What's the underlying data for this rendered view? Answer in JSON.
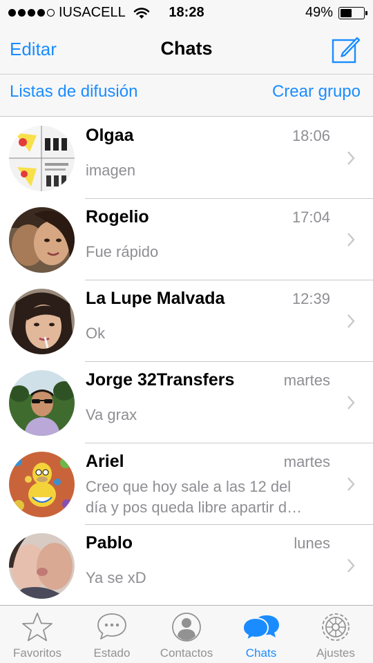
{
  "status_bar": {
    "carrier": "IUSACELL",
    "time": "18:28",
    "battery": "49%",
    "battery_level": 0.49,
    "signal_bars": 4,
    "signal_total": 5
  },
  "nav": {
    "edit_label": "Editar",
    "title": "Chats",
    "compose_icon": "compose-icon"
  },
  "sub_bar": {
    "broadcast_label": "Listas de difusión",
    "new_group_label": "Crear grupo"
  },
  "chats": [
    {
      "name": "Olgaa",
      "time": "18:06",
      "message": [
        "imagen"
      ]
    },
    {
      "name": "Rogelio",
      "time": "17:04",
      "message": [
        "Fue rápido"
      ]
    },
    {
      "name": "La Lupe Malvada",
      "time": "12:39",
      "message": [
        "Ok"
      ]
    },
    {
      "name": "Jorge 32Transfers",
      "time": "martes",
      "message": [
        "Va grax"
      ]
    },
    {
      "name": "Ariel",
      "time": "martes",
      "message": [
        "Creo que hoy sale a las 12 del",
        "día y pos queda libre apartir d…"
      ]
    },
    {
      "name": "Pablo",
      "time": "lunes",
      "message": [
        "Ya se xD"
      ]
    }
  ],
  "tabs": [
    {
      "label": "Favoritos",
      "icon": "star-icon",
      "active": false
    },
    {
      "label": "Estado",
      "icon": "speech-bubble-icon",
      "active": false
    },
    {
      "label": "Contactos",
      "icon": "person-icon",
      "active": false
    },
    {
      "label": "Chats",
      "icon": "chats-icon",
      "active": true
    },
    {
      "label": "Ajustes",
      "icon": "gear-icon",
      "active": false
    }
  ],
  "colors": {
    "accent": "#1a8cff",
    "secondary_text": "#8e8e93",
    "bar_background": "#f7f7f7",
    "separator": "#c8c7cc",
    "inactive_tab": "#929292"
  }
}
